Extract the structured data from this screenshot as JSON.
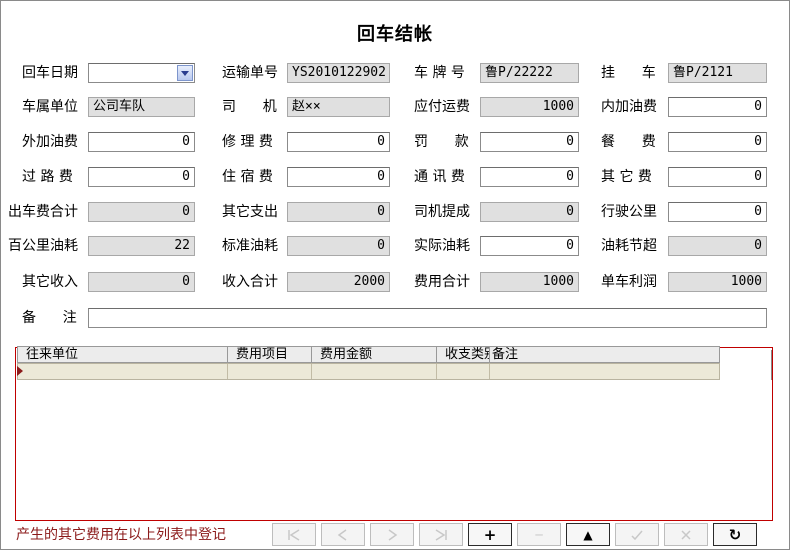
{
  "title": "回车结帐",
  "fields": {
    "return_date": {
      "label": "回车日期",
      "value": ""
    },
    "waybill_no": {
      "label": "运输单号",
      "value": "YS2010122902"
    },
    "plate_no": {
      "label": "车 牌 号",
      "value": "鲁P/22222"
    },
    "trailer": {
      "label": "挂      车",
      "value": "鲁P/2121"
    },
    "vehicle_unit": {
      "label": "车属单位",
      "value": "公司车队"
    },
    "driver": {
      "label": "司      机",
      "value": "赵××"
    },
    "freight_payable": {
      "label": "应付运费",
      "value": "1000"
    },
    "inner_fuel_fee": {
      "label": "内加油费",
      "value": "0"
    },
    "outer_fuel_fee": {
      "label": "外加油费",
      "value": "0"
    },
    "repair_fee": {
      "label": "修 理 费",
      "value": "0"
    },
    "fine": {
      "label": "罚      款",
      "value": "0"
    },
    "meal_fee": {
      "label": "餐      费",
      "value": "0"
    },
    "toll_fee": {
      "label": "过 路 费",
      "value": "0"
    },
    "lodging_fee": {
      "label": "住 宿 费",
      "value": "0"
    },
    "comm_fee": {
      "label": "通 讯 费",
      "value": "0"
    },
    "other_fee": {
      "label": "其 它 费",
      "value": "0"
    },
    "trip_cost_total": {
      "label": "出车费合计",
      "value": "0"
    },
    "other_expense": {
      "label": "其它支出",
      "value": "0"
    },
    "driver_commission": {
      "label": "司机提成",
      "value": "0"
    },
    "mileage": {
      "label": "行驶公里",
      "value": "0"
    },
    "fuel_per_100km": {
      "label": "百公里油耗",
      "value": "22"
    },
    "standard_fuel": {
      "label": "标准油耗",
      "value": "0"
    },
    "actual_fuel": {
      "label": "实际油耗",
      "value": "0"
    },
    "fuel_saving": {
      "label": "油耗节超",
      "value": "0"
    },
    "other_income": {
      "label": "其它收入",
      "value": "0"
    },
    "income_total": {
      "label": "收入合计",
      "value": "2000"
    },
    "expense_total": {
      "label": "费用合计",
      "value": "1000"
    },
    "vehicle_profit": {
      "label": "单车利润",
      "value": "1000"
    },
    "remarks": {
      "label": "备      注",
      "value": ""
    }
  },
  "grid": {
    "columns": [
      "往来单位",
      "费用项目",
      "费用金额",
      "收支类别",
      "备注"
    ]
  },
  "hint": "产生的其它费用在以上列表中登记",
  "nav": [
    "first",
    "prev",
    "next",
    "last",
    "add",
    "delete",
    "edit",
    "save",
    "cancel",
    "refresh"
  ],
  "nav_labels": {
    "add": "+",
    "delete": "─",
    "edit": "▲",
    "refresh": "↻"
  }
}
